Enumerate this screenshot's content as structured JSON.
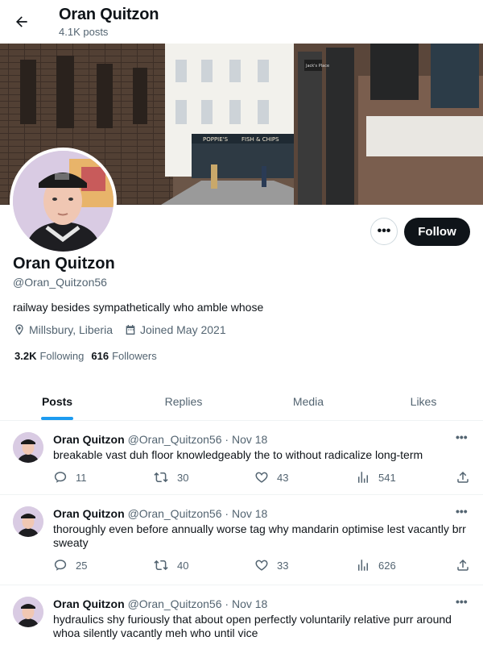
{
  "header": {
    "name": "Oran Quitzon",
    "posts_count": "4.1K posts"
  },
  "profile": {
    "name": "Oran Quitzon",
    "handle": "@Oran_Quitzon56",
    "bio": "railway besides sympathetically who amble whose",
    "location": "Millsbury, Liberia",
    "joined": "Joined May 2021",
    "following_count": "3.2K",
    "following_label": "Following",
    "followers_count": "616",
    "followers_label": "Followers",
    "follow_button": "Follow",
    "more_button": "•••"
  },
  "banner": {
    "sign_left": "POPPIE'S",
    "sign_right": "FISH & CHIPS",
    "sign_small": "Jack's Place"
  },
  "tabs": [
    {
      "label": "Posts",
      "active": true
    },
    {
      "label": "Replies",
      "active": false
    },
    {
      "label": "Media",
      "active": false
    },
    {
      "label": "Likes",
      "active": false
    }
  ],
  "tweets": [
    {
      "name": "Oran Quitzon",
      "handle": "@Oran_Quitzon56",
      "date": "· Nov 18",
      "text": "breakable vast duh floor knowledgeably the to without radicalize long-term",
      "replies": "11",
      "reposts": "30",
      "likes": "43",
      "views": "541"
    },
    {
      "name": "Oran Quitzon",
      "handle": "@Oran_Quitzon56",
      "date": "· Nov 18",
      "text": "thoroughly even before annually worse tag why mandarin optimise lest vacantly brr sweaty",
      "replies": "25",
      "reposts": "40",
      "likes": "33",
      "views": "626"
    },
    {
      "name": "Oran Quitzon",
      "handle": "@Oran_Quitzon56",
      "date": "· Nov 18",
      "text": "hydraulics shy furiously that about open perfectly voluntarily relative purr around whoa silently vacantly meh who until vice",
      "replies": "",
      "reposts": "",
      "likes": "",
      "views": ""
    }
  ],
  "icons": {
    "back": "arrow-left-icon",
    "location": "location-pin-icon",
    "calendar": "calendar-icon",
    "reply": "reply-icon",
    "repost": "repost-icon",
    "like": "heart-icon",
    "views": "views-chart-icon",
    "share": "share-icon"
  },
  "colors": {
    "accent": "#1d9bf0",
    "text": "#0f1419",
    "muted": "#536471",
    "follow_bg": "#0f1419"
  }
}
